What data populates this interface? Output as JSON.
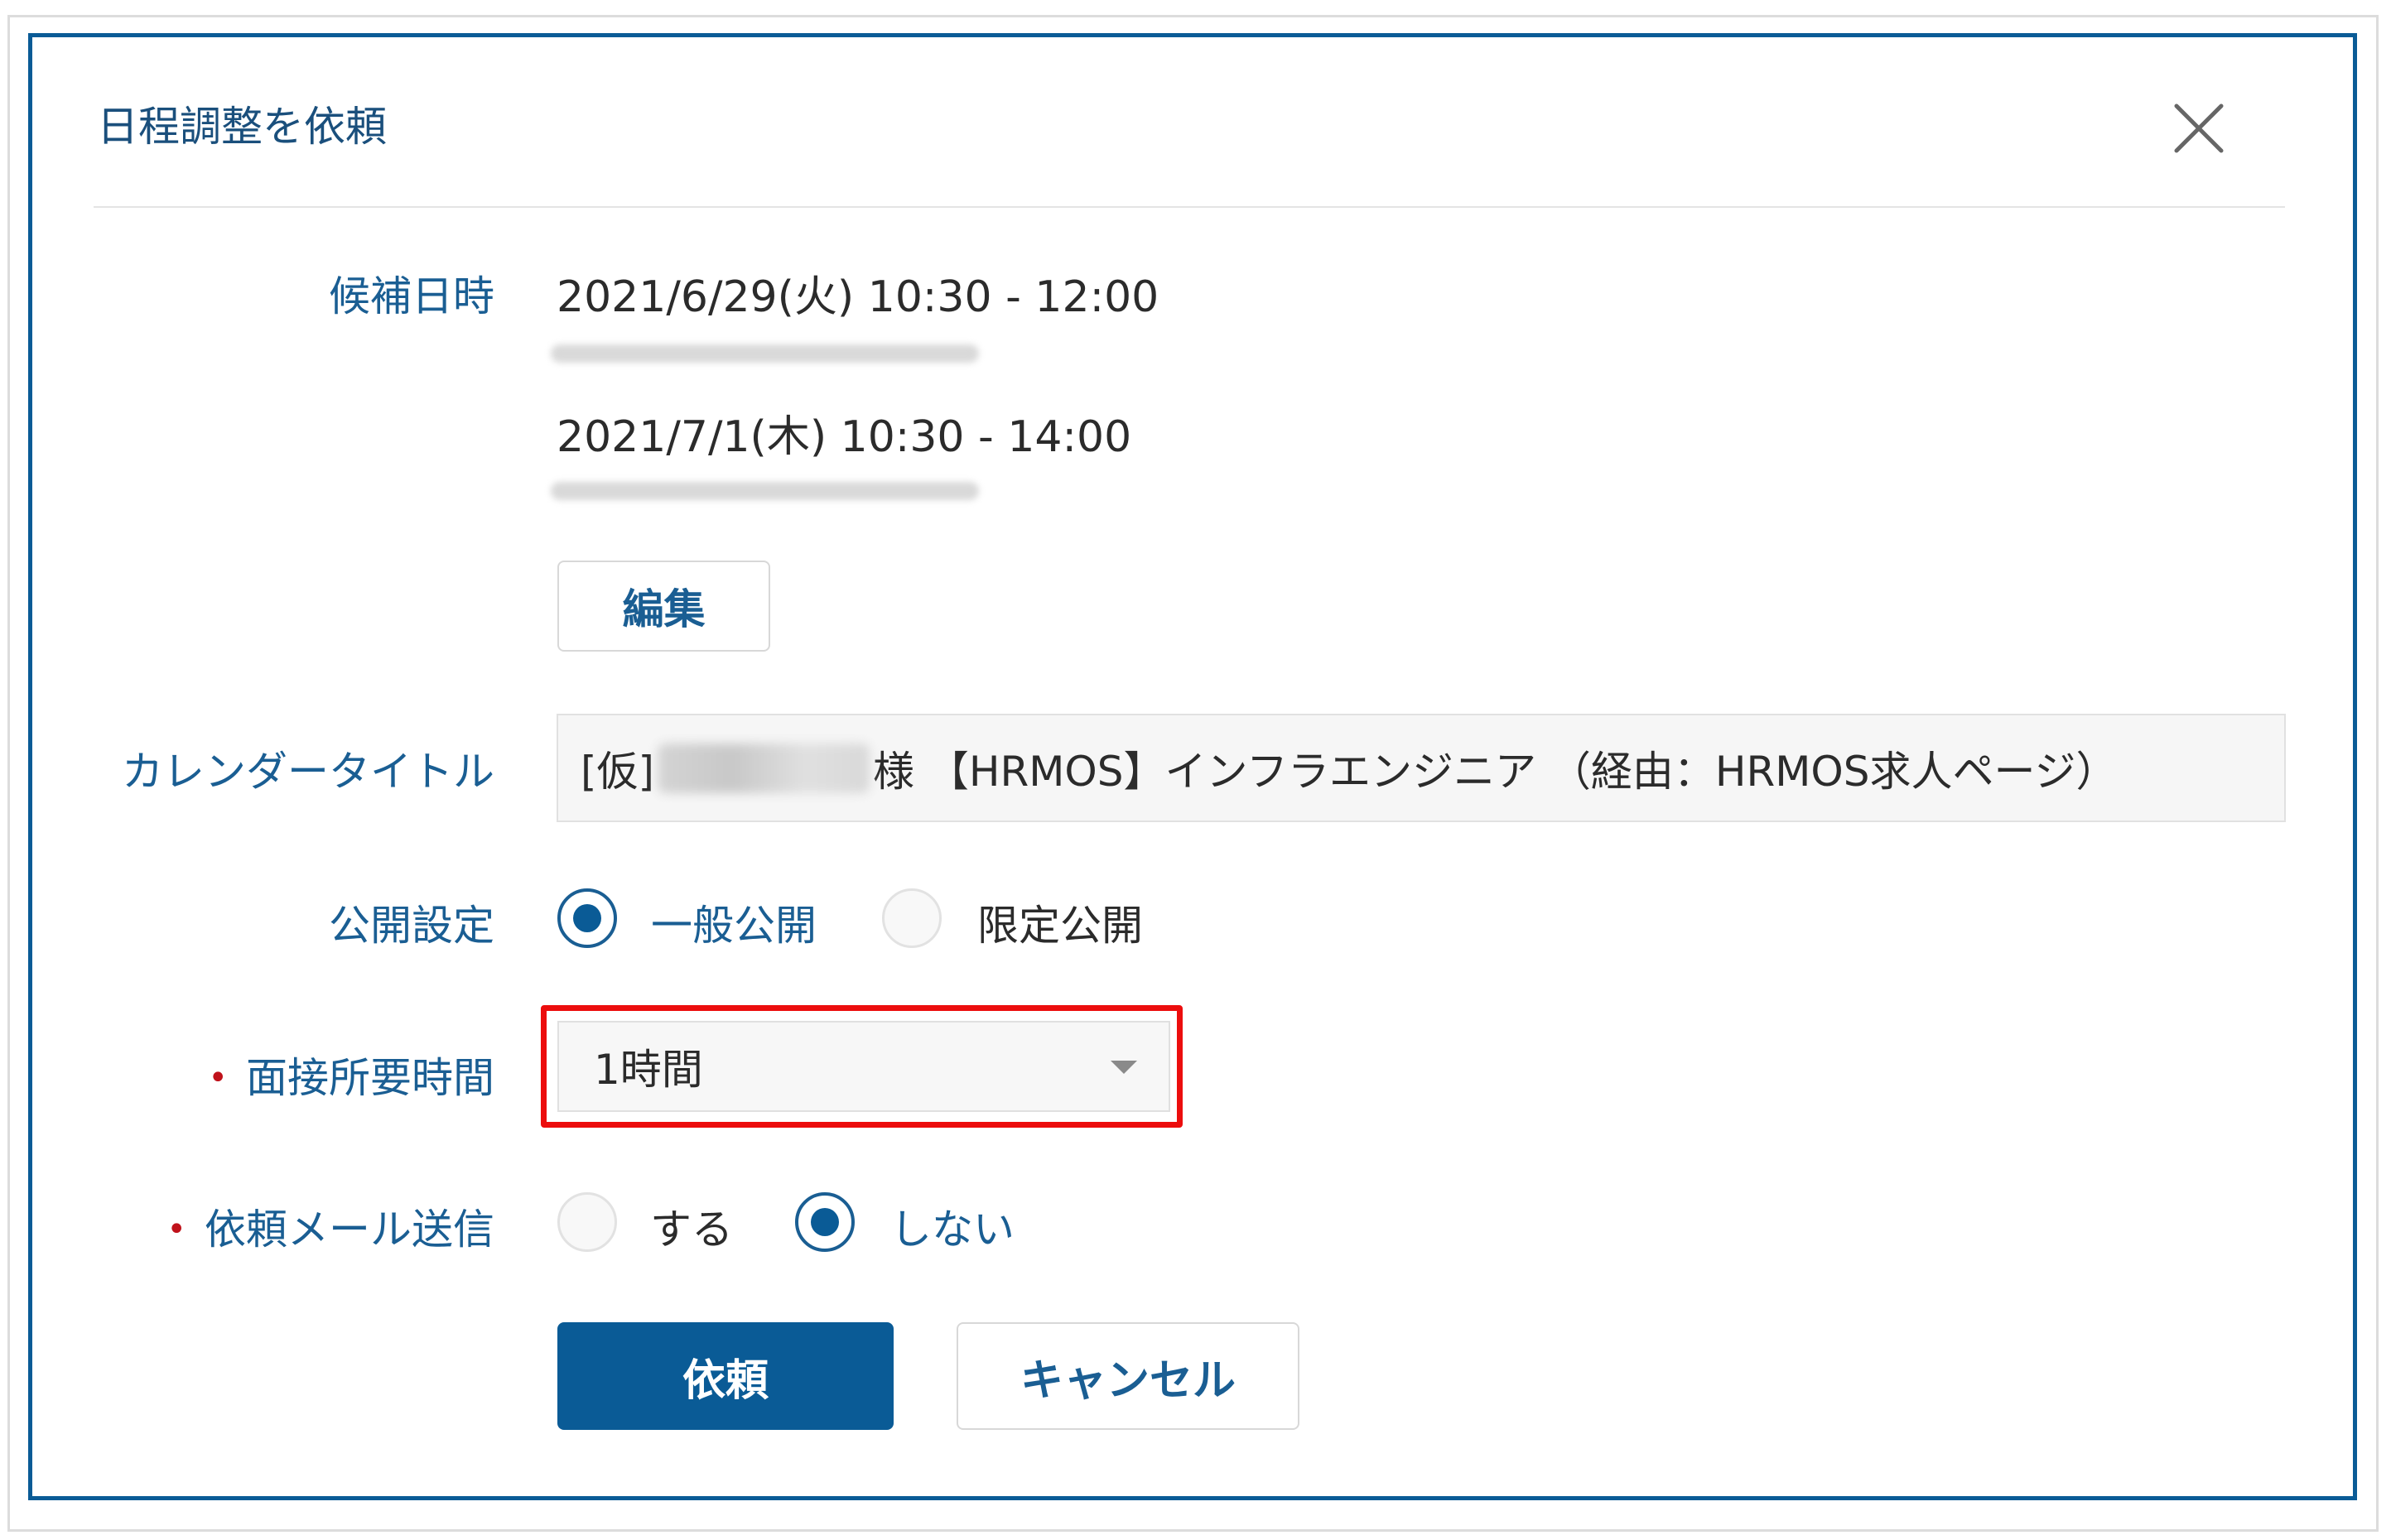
{
  "dialog": {
    "title": "日程調整を依頼",
    "close_icon": "close-icon"
  },
  "candidate": {
    "label": "候補日時",
    "slots": [
      "2021/6/29(火) 10:30 - 12:00",
      "2021/7/1(木) 10:30 - 14:00"
    ],
    "edit_label": "編集"
  },
  "calendar_title": {
    "label": "カレンダータイトル",
    "prefix": "[仮]",
    "suffix": "様 【HRMOS】インフラエンジニア （経由：HRMOS求人ページ）"
  },
  "visibility": {
    "label": "公開設定",
    "options": [
      "一般公開",
      "限定公開"
    ],
    "selected": "一般公開"
  },
  "duration": {
    "required_mark": "•",
    "label": "面接所要時間",
    "value": "1時間"
  },
  "request_mail": {
    "required_mark": "•",
    "label": "依頼メール送信",
    "options": [
      "する",
      "しない"
    ],
    "selected": "しない"
  },
  "actions": {
    "submit_label": "依頼",
    "cancel_label": "キャンセル"
  },
  "colors": {
    "primary": "#0a5b96",
    "label": "#1a5e93",
    "required": "#c0121b",
    "highlight": "#ec0d0d"
  }
}
